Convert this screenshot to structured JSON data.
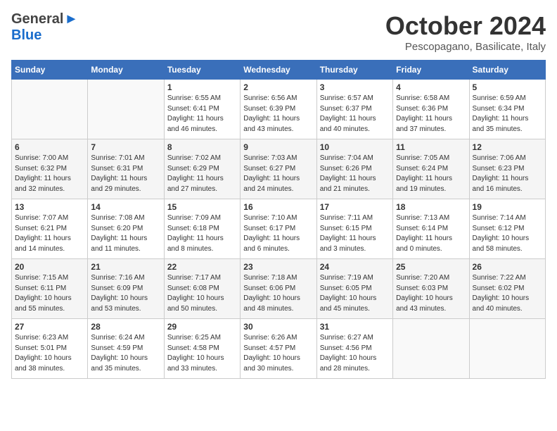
{
  "header": {
    "logo_general": "General",
    "logo_blue": "Blue",
    "month_title": "October 2024",
    "location": "Pescopagano, Basilicate, Italy"
  },
  "weekdays": [
    "Sunday",
    "Monday",
    "Tuesday",
    "Wednesday",
    "Thursday",
    "Friday",
    "Saturday"
  ],
  "weeks": [
    [
      {
        "day": "",
        "info": ""
      },
      {
        "day": "",
        "info": ""
      },
      {
        "day": "1",
        "info": "Sunrise: 6:55 AM\nSunset: 6:41 PM\nDaylight: 11 hours\nand 46 minutes."
      },
      {
        "day": "2",
        "info": "Sunrise: 6:56 AM\nSunset: 6:39 PM\nDaylight: 11 hours\nand 43 minutes."
      },
      {
        "day": "3",
        "info": "Sunrise: 6:57 AM\nSunset: 6:37 PM\nDaylight: 11 hours\nand 40 minutes."
      },
      {
        "day": "4",
        "info": "Sunrise: 6:58 AM\nSunset: 6:36 PM\nDaylight: 11 hours\nand 37 minutes."
      },
      {
        "day": "5",
        "info": "Sunrise: 6:59 AM\nSunset: 6:34 PM\nDaylight: 11 hours\nand 35 minutes."
      }
    ],
    [
      {
        "day": "6",
        "info": "Sunrise: 7:00 AM\nSunset: 6:32 PM\nDaylight: 11 hours\nand 32 minutes."
      },
      {
        "day": "7",
        "info": "Sunrise: 7:01 AM\nSunset: 6:31 PM\nDaylight: 11 hours\nand 29 minutes."
      },
      {
        "day": "8",
        "info": "Sunrise: 7:02 AM\nSunset: 6:29 PM\nDaylight: 11 hours\nand 27 minutes."
      },
      {
        "day": "9",
        "info": "Sunrise: 7:03 AM\nSunset: 6:27 PM\nDaylight: 11 hours\nand 24 minutes."
      },
      {
        "day": "10",
        "info": "Sunrise: 7:04 AM\nSunset: 6:26 PM\nDaylight: 11 hours\nand 21 minutes."
      },
      {
        "day": "11",
        "info": "Sunrise: 7:05 AM\nSunset: 6:24 PM\nDaylight: 11 hours\nand 19 minutes."
      },
      {
        "day": "12",
        "info": "Sunrise: 7:06 AM\nSunset: 6:23 PM\nDaylight: 11 hours\nand 16 minutes."
      }
    ],
    [
      {
        "day": "13",
        "info": "Sunrise: 7:07 AM\nSunset: 6:21 PM\nDaylight: 11 hours\nand 14 minutes."
      },
      {
        "day": "14",
        "info": "Sunrise: 7:08 AM\nSunset: 6:20 PM\nDaylight: 11 hours\nand 11 minutes."
      },
      {
        "day": "15",
        "info": "Sunrise: 7:09 AM\nSunset: 6:18 PM\nDaylight: 11 hours\nand 8 minutes."
      },
      {
        "day": "16",
        "info": "Sunrise: 7:10 AM\nSunset: 6:17 PM\nDaylight: 11 hours\nand 6 minutes."
      },
      {
        "day": "17",
        "info": "Sunrise: 7:11 AM\nSunset: 6:15 PM\nDaylight: 11 hours\nand 3 minutes."
      },
      {
        "day": "18",
        "info": "Sunrise: 7:13 AM\nSunset: 6:14 PM\nDaylight: 11 hours\nand 0 minutes."
      },
      {
        "day": "19",
        "info": "Sunrise: 7:14 AM\nSunset: 6:12 PM\nDaylight: 10 hours\nand 58 minutes."
      }
    ],
    [
      {
        "day": "20",
        "info": "Sunrise: 7:15 AM\nSunset: 6:11 PM\nDaylight: 10 hours\nand 55 minutes."
      },
      {
        "day": "21",
        "info": "Sunrise: 7:16 AM\nSunset: 6:09 PM\nDaylight: 10 hours\nand 53 minutes."
      },
      {
        "day": "22",
        "info": "Sunrise: 7:17 AM\nSunset: 6:08 PM\nDaylight: 10 hours\nand 50 minutes."
      },
      {
        "day": "23",
        "info": "Sunrise: 7:18 AM\nSunset: 6:06 PM\nDaylight: 10 hours\nand 48 minutes."
      },
      {
        "day": "24",
        "info": "Sunrise: 7:19 AM\nSunset: 6:05 PM\nDaylight: 10 hours\nand 45 minutes."
      },
      {
        "day": "25",
        "info": "Sunrise: 7:20 AM\nSunset: 6:03 PM\nDaylight: 10 hours\nand 43 minutes."
      },
      {
        "day": "26",
        "info": "Sunrise: 7:22 AM\nSunset: 6:02 PM\nDaylight: 10 hours\nand 40 minutes."
      }
    ],
    [
      {
        "day": "27",
        "info": "Sunrise: 6:23 AM\nSunset: 5:01 PM\nDaylight: 10 hours\nand 38 minutes."
      },
      {
        "day": "28",
        "info": "Sunrise: 6:24 AM\nSunset: 4:59 PM\nDaylight: 10 hours\nand 35 minutes."
      },
      {
        "day": "29",
        "info": "Sunrise: 6:25 AM\nSunset: 4:58 PM\nDaylight: 10 hours\nand 33 minutes."
      },
      {
        "day": "30",
        "info": "Sunrise: 6:26 AM\nSunset: 4:57 PM\nDaylight: 10 hours\nand 30 minutes."
      },
      {
        "day": "31",
        "info": "Sunrise: 6:27 AM\nSunset: 4:56 PM\nDaylight: 10 hours\nand 28 minutes."
      },
      {
        "day": "",
        "info": ""
      },
      {
        "day": "",
        "info": ""
      }
    ]
  ]
}
